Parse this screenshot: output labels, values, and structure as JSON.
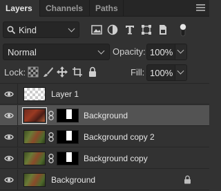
{
  "tabs": [
    {
      "label": "Layers",
      "active": true
    },
    {
      "label": "Channels",
      "active": false
    },
    {
      "label": "Paths",
      "active": false
    }
  ],
  "filter": {
    "kind_label": "Kind",
    "icons": [
      "pixel-layer-filter-icon",
      "adjustment-layer-filter-icon",
      "type-layer-filter-icon",
      "shape-layer-filter-icon",
      "smart-object-filter-icon",
      "filter-toggle-icon"
    ]
  },
  "blend": {
    "mode": "Normal",
    "opacity_label": "Opacity:",
    "opacity_value": "100%"
  },
  "lock": {
    "label": "Lock:",
    "fill_label": "Fill:",
    "fill_value": "100%"
  },
  "layers": [
    {
      "name": "Layer 1",
      "visible": true,
      "thumb": "transparent",
      "has_mask": false,
      "selected": false,
      "locked": false
    },
    {
      "name": "Background",
      "visible": true,
      "thumb": "photo-red",
      "has_mask": true,
      "selected": true,
      "locked": false
    },
    {
      "name": "Background copy 2",
      "visible": true,
      "thumb": "photo-green",
      "has_mask": true,
      "selected": false,
      "locked": false
    },
    {
      "name": "Background copy",
      "visible": true,
      "thumb": "photo-green",
      "has_mask": true,
      "selected": false,
      "locked": false
    },
    {
      "name": "Background",
      "visible": true,
      "thumb": "photo-green",
      "has_mask": false,
      "selected": false,
      "locked": true
    }
  ],
  "colors": {
    "panel_bg": "#323232",
    "selected_row": "#535353",
    "field_bg": "#262626"
  }
}
